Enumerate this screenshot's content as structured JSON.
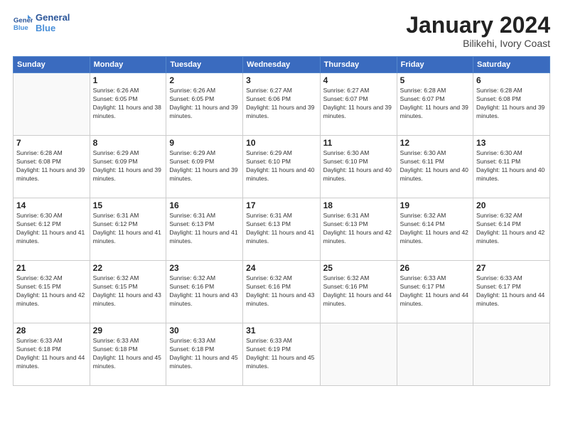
{
  "header": {
    "logo_line1": "General",
    "logo_line2": "Blue",
    "month": "January 2024",
    "location": "Bilikehi, Ivory Coast"
  },
  "weekdays": [
    "Sunday",
    "Monday",
    "Tuesday",
    "Wednesday",
    "Thursday",
    "Friday",
    "Saturday"
  ],
  "weeks": [
    [
      {
        "day": "",
        "sunrise": "",
        "sunset": "",
        "daylight": ""
      },
      {
        "day": "1",
        "sunrise": "Sunrise: 6:26 AM",
        "sunset": "Sunset: 6:05 PM",
        "daylight": "Daylight: 11 hours and 38 minutes."
      },
      {
        "day": "2",
        "sunrise": "Sunrise: 6:26 AM",
        "sunset": "Sunset: 6:05 PM",
        "daylight": "Daylight: 11 hours and 39 minutes."
      },
      {
        "day": "3",
        "sunrise": "Sunrise: 6:27 AM",
        "sunset": "Sunset: 6:06 PM",
        "daylight": "Daylight: 11 hours and 39 minutes."
      },
      {
        "day": "4",
        "sunrise": "Sunrise: 6:27 AM",
        "sunset": "Sunset: 6:07 PM",
        "daylight": "Daylight: 11 hours and 39 minutes."
      },
      {
        "day": "5",
        "sunrise": "Sunrise: 6:28 AM",
        "sunset": "Sunset: 6:07 PM",
        "daylight": "Daylight: 11 hours and 39 minutes."
      },
      {
        "day": "6",
        "sunrise": "Sunrise: 6:28 AM",
        "sunset": "Sunset: 6:08 PM",
        "daylight": "Daylight: 11 hours and 39 minutes."
      }
    ],
    [
      {
        "day": "7",
        "sunrise": "Sunrise: 6:28 AM",
        "sunset": "Sunset: 6:08 PM",
        "daylight": "Daylight: 11 hours and 39 minutes."
      },
      {
        "day": "8",
        "sunrise": "Sunrise: 6:29 AM",
        "sunset": "Sunset: 6:09 PM",
        "daylight": "Daylight: 11 hours and 39 minutes."
      },
      {
        "day": "9",
        "sunrise": "Sunrise: 6:29 AM",
        "sunset": "Sunset: 6:09 PM",
        "daylight": "Daylight: 11 hours and 39 minutes."
      },
      {
        "day": "10",
        "sunrise": "Sunrise: 6:29 AM",
        "sunset": "Sunset: 6:10 PM",
        "daylight": "Daylight: 11 hours and 40 minutes."
      },
      {
        "day": "11",
        "sunrise": "Sunrise: 6:30 AM",
        "sunset": "Sunset: 6:10 PM",
        "daylight": "Daylight: 11 hours and 40 minutes."
      },
      {
        "day": "12",
        "sunrise": "Sunrise: 6:30 AM",
        "sunset": "Sunset: 6:11 PM",
        "daylight": "Daylight: 11 hours and 40 minutes."
      },
      {
        "day": "13",
        "sunrise": "Sunrise: 6:30 AM",
        "sunset": "Sunset: 6:11 PM",
        "daylight": "Daylight: 11 hours and 40 minutes."
      }
    ],
    [
      {
        "day": "14",
        "sunrise": "Sunrise: 6:30 AM",
        "sunset": "Sunset: 6:12 PM",
        "daylight": "Daylight: 11 hours and 41 minutes."
      },
      {
        "day": "15",
        "sunrise": "Sunrise: 6:31 AM",
        "sunset": "Sunset: 6:12 PM",
        "daylight": "Daylight: 11 hours and 41 minutes."
      },
      {
        "day": "16",
        "sunrise": "Sunrise: 6:31 AM",
        "sunset": "Sunset: 6:13 PM",
        "daylight": "Daylight: 11 hours and 41 minutes."
      },
      {
        "day": "17",
        "sunrise": "Sunrise: 6:31 AM",
        "sunset": "Sunset: 6:13 PM",
        "daylight": "Daylight: 11 hours and 41 minutes."
      },
      {
        "day": "18",
        "sunrise": "Sunrise: 6:31 AM",
        "sunset": "Sunset: 6:13 PM",
        "daylight": "Daylight: 11 hours and 42 minutes."
      },
      {
        "day": "19",
        "sunrise": "Sunrise: 6:32 AM",
        "sunset": "Sunset: 6:14 PM",
        "daylight": "Daylight: 11 hours and 42 minutes."
      },
      {
        "day": "20",
        "sunrise": "Sunrise: 6:32 AM",
        "sunset": "Sunset: 6:14 PM",
        "daylight": "Daylight: 11 hours and 42 minutes."
      }
    ],
    [
      {
        "day": "21",
        "sunrise": "Sunrise: 6:32 AM",
        "sunset": "Sunset: 6:15 PM",
        "daylight": "Daylight: 11 hours and 42 minutes."
      },
      {
        "day": "22",
        "sunrise": "Sunrise: 6:32 AM",
        "sunset": "Sunset: 6:15 PM",
        "daylight": "Daylight: 11 hours and 43 minutes."
      },
      {
        "day": "23",
        "sunrise": "Sunrise: 6:32 AM",
        "sunset": "Sunset: 6:16 PM",
        "daylight": "Daylight: 11 hours and 43 minutes."
      },
      {
        "day": "24",
        "sunrise": "Sunrise: 6:32 AM",
        "sunset": "Sunset: 6:16 PM",
        "daylight": "Daylight: 11 hours and 43 minutes."
      },
      {
        "day": "25",
        "sunrise": "Sunrise: 6:32 AM",
        "sunset": "Sunset: 6:16 PM",
        "daylight": "Daylight: 11 hours and 44 minutes."
      },
      {
        "day": "26",
        "sunrise": "Sunrise: 6:33 AM",
        "sunset": "Sunset: 6:17 PM",
        "daylight": "Daylight: 11 hours and 44 minutes."
      },
      {
        "day": "27",
        "sunrise": "Sunrise: 6:33 AM",
        "sunset": "Sunset: 6:17 PM",
        "daylight": "Daylight: 11 hours and 44 minutes."
      }
    ],
    [
      {
        "day": "28",
        "sunrise": "Sunrise: 6:33 AM",
        "sunset": "Sunset: 6:18 PM",
        "daylight": "Daylight: 11 hours and 44 minutes."
      },
      {
        "day": "29",
        "sunrise": "Sunrise: 6:33 AM",
        "sunset": "Sunset: 6:18 PM",
        "daylight": "Daylight: 11 hours and 45 minutes."
      },
      {
        "day": "30",
        "sunrise": "Sunrise: 6:33 AM",
        "sunset": "Sunset: 6:18 PM",
        "daylight": "Daylight: 11 hours and 45 minutes."
      },
      {
        "day": "31",
        "sunrise": "Sunrise: 6:33 AM",
        "sunset": "Sunset: 6:19 PM",
        "daylight": "Daylight: 11 hours and 45 minutes."
      },
      {
        "day": "",
        "sunrise": "",
        "sunset": "",
        "daylight": ""
      },
      {
        "day": "",
        "sunrise": "",
        "sunset": "",
        "daylight": ""
      },
      {
        "day": "",
        "sunrise": "",
        "sunset": "",
        "daylight": ""
      }
    ]
  ]
}
